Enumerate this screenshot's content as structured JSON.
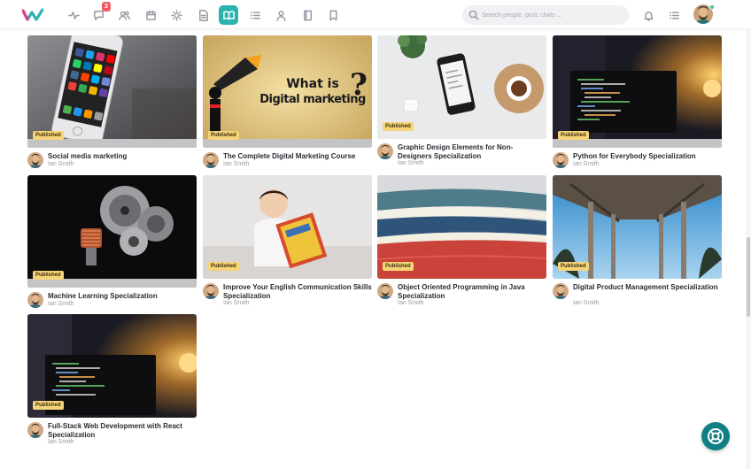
{
  "header": {
    "badge_count": "3",
    "search_placeholder": "Search people, post, chats ...",
    "nav_icons": [
      "activity-icon",
      "chat-icon",
      "users-icon",
      "calendar-icon",
      "sun-icon",
      "document-icon",
      "open-book-icon",
      "list-icon",
      "user-icon",
      "book-icon",
      "bookmark-icon"
    ],
    "right_icons": [
      "bell-icon",
      "menu-icon"
    ],
    "accent_color": "#2bb3b0"
  },
  "status_label": "Published",
  "courses": [
    {
      "title": "Social media marketing",
      "author": "Ian Smith"
    },
    {
      "title": "The Complete Digital Marketing Course",
      "author": "Ian Smith"
    },
    {
      "title": "Graphic Design Elements for Non-Designers Specialization",
      "author": "Ian Smith"
    },
    {
      "title": "Python for Everybody Specialization",
      "author": "Ian Smith"
    },
    {
      "title": "Machine Learning Specialization",
      "author": "Ian Smith"
    },
    {
      "title": "Improve Your English Communication Skills Specialization",
      "author": "Ian Smith"
    },
    {
      "title": "Object Oriented Programming in Java Specialization",
      "author": "Ian Smith"
    },
    {
      "title": "Digital Product Management Specialization",
      "author": "Ian Smith"
    },
    {
      "title": "Full-Stack Web Development with React Specialization",
      "author": "Ian Smith"
    }
  ],
  "banner_text": {
    "line1": "What is",
    "line2": "Digital marketing"
  },
  "help_button": "help-lifebuoy-icon"
}
